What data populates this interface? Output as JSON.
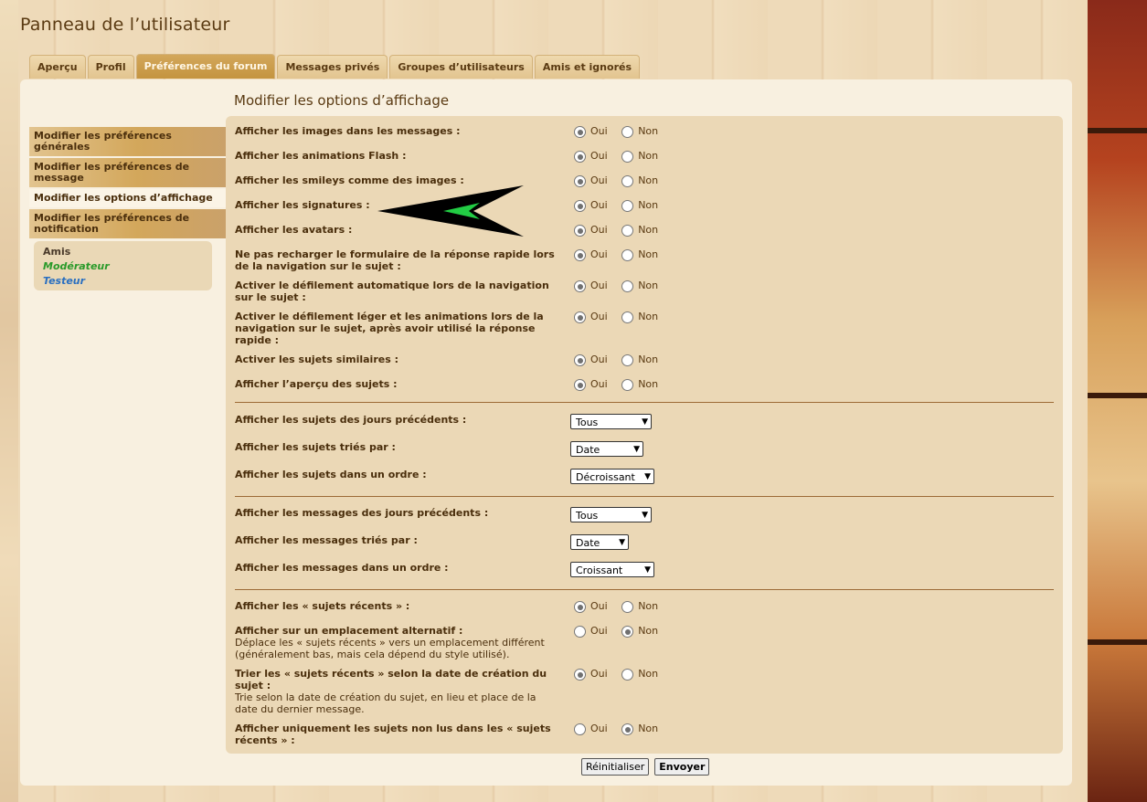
{
  "page_title": "Panneau de l’utilisateur",
  "tabs": [
    {
      "label": "Aperçu"
    },
    {
      "label": "Profil"
    },
    {
      "label": "Préférences du forum"
    },
    {
      "label": "Messages privés"
    },
    {
      "label": "Groupes d’utilisateurs"
    },
    {
      "label": "Amis et ignorés"
    }
  ],
  "section_title": "Modifier les options d’affichage",
  "sidebar": {
    "items": [
      {
        "label": "Modifier les préférences générales"
      },
      {
        "label": "Modifier les préférences de message"
      },
      {
        "label": "Modifier les options d’affichage"
      },
      {
        "label": "Modifier les préférences de notification"
      }
    ],
    "friends": {
      "heading": "Amis",
      "members": [
        {
          "name": "Modérateur",
          "color": "#2a9a2a"
        },
        {
          "name": "Testeur",
          "color": "#2a6fc0"
        }
      ]
    }
  },
  "options": {
    "yes": "Oui",
    "no": "Non"
  },
  "radios": [
    {
      "label": "Afficher les images dans les messages :",
      "value": "yes"
    },
    {
      "label": "Afficher les animations Flash :",
      "value": "yes"
    },
    {
      "label": "Afficher les smileys comme des images :",
      "value": "yes"
    },
    {
      "label": "Afficher les signatures :",
      "value": "yes"
    },
    {
      "label": "Afficher les avatars :",
      "value": "yes"
    },
    {
      "label": "Ne pas recharger le formulaire de la réponse rapide lors de la navigation sur le sujet :",
      "value": "yes"
    },
    {
      "label": "Activer le défilement automatique lors de la navigation sur le sujet :",
      "value": "yes"
    },
    {
      "label": "Activer le défilement léger et les animations lors de la navigation sur le sujet, après avoir utilisé la réponse rapide :",
      "value": "yes"
    },
    {
      "label": "Activer les sujets similaires :",
      "value": "yes"
    },
    {
      "label": "Afficher l’aperçu des sujets :",
      "value": "yes"
    }
  ],
  "topic_selects": [
    {
      "label": "Afficher les sujets des jours précédents :",
      "value": "Tous"
    },
    {
      "label": "Afficher les sujets triés par :",
      "value": "Date"
    },
    {
      "label": "Afficher les sujets dans un ordre :",
      "value": "Décroissant"
    }
  ],
  "post_selects": [
    {
      "label": "Afficher les messages des jours précédents :",
      "value": "Tous"
    },
    {
      "label": "Afficher les messages triés par :",
      "value": "Date"
    },
    {
      "label": "Afficher les messages dans un ordre :",
      "value": "Croissant"
    }
  ],
  "recent": [
    {
      "label": "Afficher les « sujets récents » :",
      "desc": "",
      "value": "yes"
    },
    {
      "label": "Afficher sur un emplacement alternatif :",
      "desc": "Déplace les « sujets récents » vers un emplacement différent (généralement bas, mais cela dépend du style utilisé).",
      "value": "no"
    },
    {
      "label": "Trier les « sujets récents » selon la date de création du sujet :",
      "desc": "Trie selon la date de création du sujet, en lieu et place de la date du dernier message.",
      "value": "yes"
    },
    {
      "label": "Afficher uniquement les sujets non lus dans les « sujets récents » :",
      "desc": "",
      "value": "no"
    }
  ],
  "buttons": {
    "reset": "Réinitialiser",
    "submit": "Envoyer"
  }
}
